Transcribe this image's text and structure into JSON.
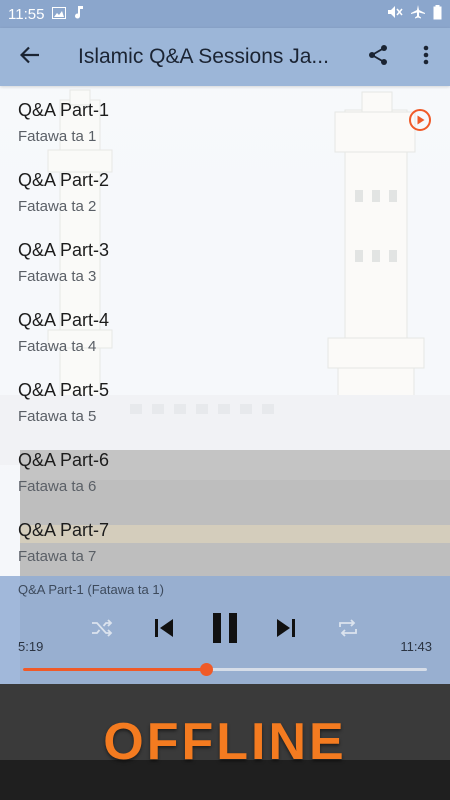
{
  "status_bar": {
    "time": "11:55",
    "icons_left": [
      "image-icon",
      "music-note-icon"
    ],
    "icons_right": [
      "mute-icon",
      "airplane-mode-icon",
      "battery-icon"
    ]
  },
  "app_bar": {
    "title": "Islamic Q&A Sessions Ja...",
    "icons": [
      "back-arrow-icon",
      "share-icon",
      "more-vert-icon"
    ]
  },
  "tracks": [
    {
      "title": "Q&A Part-1",
      "subtitle": "Fatawa ta 1",
      "playing": true
    },
    {
      "title": "Q&A Part-2",
      "subtitle": "Fatawa ta 2"
    },
    {
      "title": "Q&A Part-3",
      "subtitle": "Fatawa ta 3"
    },
    {
      "title": "Q&A Part-4",
      "subtitle": "Fatawa ta 4"
    },
    {
      "title": "Q&A Part-5",
      "subtitle": "Fatawa ta 5"
    },
    {
      "title": "Q&A Part-6",
      "subtitle": "Fatawa ta 6"
    },
    {
      "title": "Q&A Part-7",
      "subtitle": "Fatawa ta 7"
    }
  ],
  "player": {
    "now_playing": "Q&A Part-1 (Fatawa ta 1)",
    "elapsed": "5:19",
    "duration": "11:43",
    "progress": 0.454,
    "controls": [
      "shuffle-icon",
      "skip-previous-icon",
      "pause-icon",
      "skip-next-icon",
      "repeat-icon"
    ]
  },
  "banner": {
    "text": "OFFLINE"
  },
  "colors": {
    "accent": "#f05a28",
    "banner_text": "#f47b20",
    "app_bar": "#9cb6d8",
    "status_bar": "#8ba6cc"
  }
}
